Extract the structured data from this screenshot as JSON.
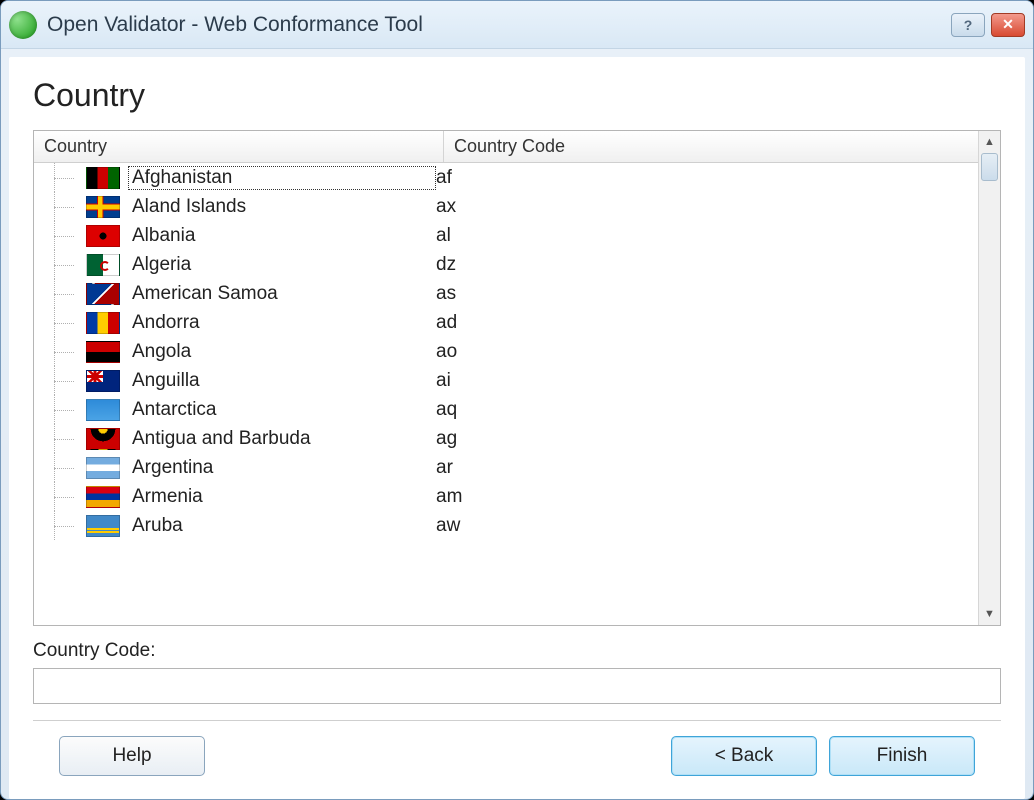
{
  "titlebar": {
    "title": "Open Validator - Web Conformance Tool"
  },
  "page": {
    "heading": "Country"
  },
  "table": {
    "columns": {
      "country": "Country",
      "code": "Country Code"
    },
    "rows": [
      {
        "name": "Afghanistan",
        "code": "af",
        "flag": "af",
        "selected": true
      },
      {
        "name": "Aland Islands",
        "code": "ax",
        "flag": "ax"
      },
      {
        "name": "Albania",
        "code": "al",
        "flag": "al"
      },
      {
        "name": "Algeria",
        "code": "dz",
        "flag": "dz"
      },
      {
        "name": "American Samoa",
        "code": "as",
        "flag": "as"
      },
      {
        "name": "Andorra",
        "code": "ad",
        "flag": "ad"
      },
      {
        "name": "Angola",
        "code": "ao",
        "flag": "ao"
      },
      {
        "name": "Anguilla",
        "code": "ai",
        "flag": "ai"
      },
      {
        "name": "Antarctica",
        "code": "aq",
        "flag": "aq"
      },
      {
        "name": "Antigua and Barbuda",
        "code": "ag",
        "flag": "ag"
      },
      {
        "name": "Argentina",
        "code": "ar",
        "flag": "ar"
      },
      {
        "name": "Armenia",
        "code": "am",
        "flag": "am"
      },
      {
        "name": "Aruba",
        "code": "aw",
        "flag": "aw"
      }
    ]
  },
  "field": {
    "label": "Country Code:",
    "value": ""
  },
  "buttons": {
    "help": "Help",
    "back": "< Back",
    "finish": "Finish"
  }
}
